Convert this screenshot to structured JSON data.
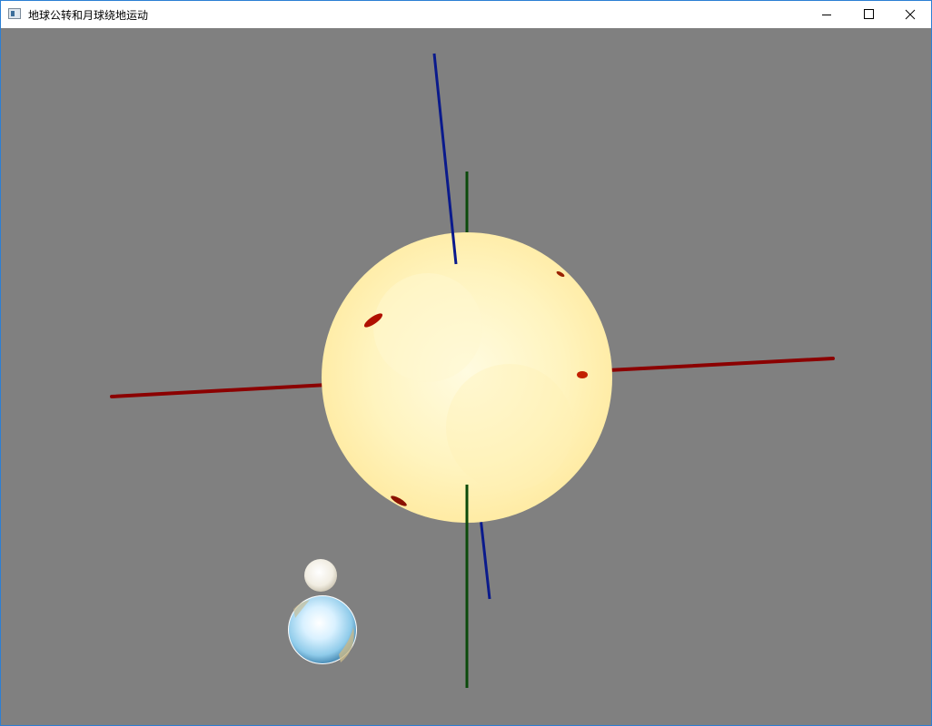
{
  "window": {
    "title": "地球公转和月球绕地运动",
    "icon": "application-window-icon"
  },
  "titlebar_buttons": {
    "minimize": "minimize-icon",
    "maximize": "maximize-icon",
    "close": "close-icon"
  },
  "scene": {
    "background_color": "#808080",
    "objects": [
      "sun",
      "earth",
      "moon",
      "x-axis",
      "y-axis",
      "z-axis"
    ],
    "colors": {
      "x_axis": "#8b0000",
      "y_axis": "#0b4a0b",
      "z_axis": "#0a1a8c",
      "sun": "#fff2b0",
      "earth": "#bfe6ff",
      "moon": "#f2efe6"
    }
  }
}
